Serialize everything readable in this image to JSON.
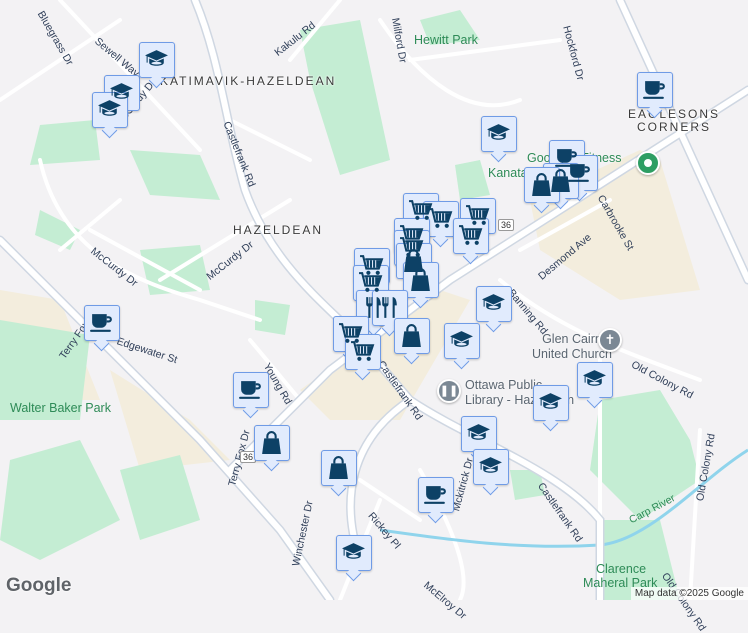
{
  "map": {
    "areas": [
      "KATIMAVIK-HAZELDEAN",
      "HAZELDEAN",
      "EAGLESONS",
      "CORNERS"
    ],
    "roads": [
      "Kakulu Rd",
      "Castlefrank Rd",
      "Sewell Way",
      "McCurdy Dr",
      "McCurdy Dr",
      "McCurdy Dr",
      "Edgewater St",
      "Terry Fox Dr",
      "Terry Fox Dr",
      "Young Rd",
      "Desmond Ave",
      "Carbrooke St",
      "Banning Rd",
      "Old Colony Rd",
      "Old Colony Rd",
      "Castlefrank Rd",
      "Castlefrank Rd",
      "Rickey Pl",
      "Winchester Dr",
      "McElroy Dr",
      "Mckitrick Dr",
      "Carp River",
      "Old Colony Rd",
      "Hockford Dr",
      "Bluegrass Dr",
      "Milford Dr"
    ],
    "parks": [
      "Hewitt Park",
      "Walter Baker Park",
      "Clarence",
      "Maheral Park"
    ],
    "pois": {
      "church_line1": "Glen Cairn",
      "church_line2": "United Church",
      "library_line1": "Ottawa Public",
      "library_line2": "Library - Hazeldean",
      "mall_line1": "GoodLife Fitness",
      "mall_line2": "Kanata Mall"
    },
    "highway_shield": "36",
    "attribution": "Map data ©2025 Google",
    "logo": "Google"
  },
  "colors": {
    "marker_fill": "#e1ebfd",
    "marker_border": "#6f9be6",
    "icon": "#0d4166",
    "park": "#c4edd3",
    "commercial": "#f3eddd"
  },
  "marker_types": [
    "education-icon",
    "cafe-icon",
    "shopping-bag-icon",
    "grocery-cart-icon",
    "restaurant-icon"
  ]
}
